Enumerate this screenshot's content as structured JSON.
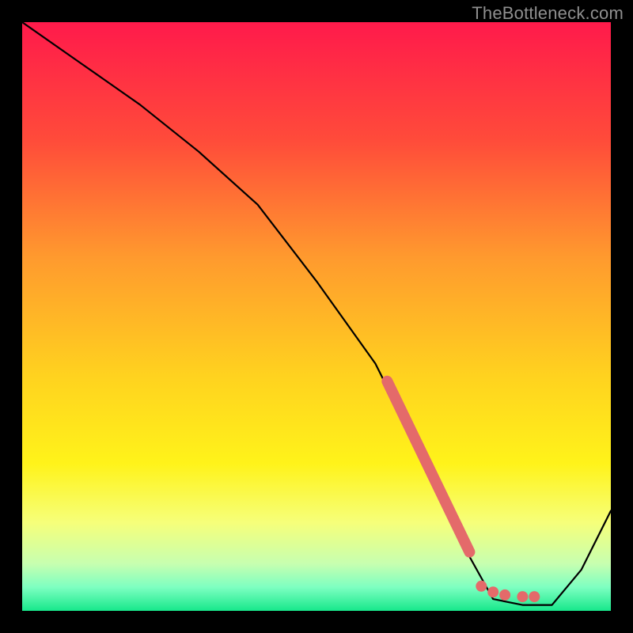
{
  "watermark": "TheBottleneck.com",
  "chart_data": {
    "type": "line",
    "title": "",
    "xlabel": "",
    "ylabel": "",
    "xlim": [
      0,
      100
    ],
    "ylim": [
      0,
      100
    ],
    "series": [
      {
        "name": "curve",
        "x": [
          0,
          10,
          20,
          30,
          40,
          50,
          60,
          65,
          70,
          75,
          80,
          85,
          90,
          95,
          100
        ],
        "y": [
          100,
          93,
          86,
          78,
          69,
          56,
          42,
          32,
          22,
          11,
          2,
          1,
          1,
          7,
          17
        ]
      }
    ],
    "highlight_segment": {
      "name": "slope-marker",
      "x": [
        62,
        76
      ],
      "y": [
        39,
        10
      ],
      "color": "#e46a6a",
      "dots": [
        {
          "x": 78,
          "y": 4.2
        },
        {
          "x": 80,
          "y": 3.2
        },
        {
          "x": 82,
          "y": 2.7
        },
        {
          "x": 85,
          "y": 2.4
        },
        {
          "x": 87,
          "y": 2.4
        }
      ]
    },
    "gradient_stops": [
      {
        "offset": 0.0,
        "color": "#ff1a4b"
      },
      {
        "offset": 0.2,
        "color": "#ff4b3a"
      },
      {
        "offset": 0.4,
        "color": "#ff9a2e"
      },
      {
        "offset": 0.6,
        "color": "#ffd21f"
      },
      {
        "offset": 0.75,
        "color": "#fff31a"
      },
      {
        "offset": 0.85,
        "color": "#f6ff7a"
      },
      {
        "offset": 0.92,
        "color": "#c7ffb0"
      },
      {
        "offset": 0.96,
        "color": "#7dffc1"
      },
      {
        "offset": 1.0,
        "color": "#17e88b"
      }
    ]
  }
}
